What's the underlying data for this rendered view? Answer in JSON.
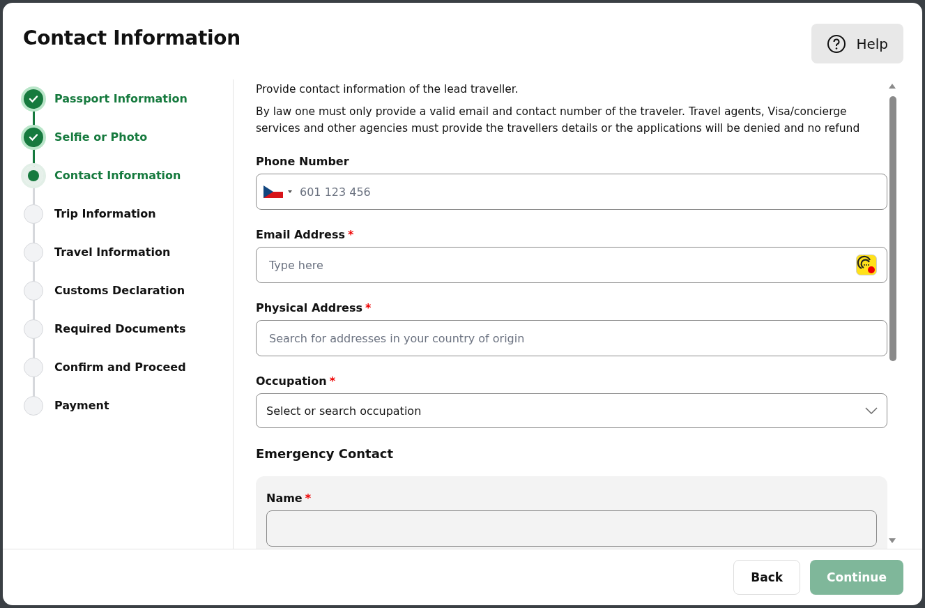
{
  "dialog": {
    "title": "Contact Information",
    "help_button": {
      "label": "Help"
    }
  },
  "steps": [
    {
      "label": "Passport Information",
      "completed": true,
      "selected": false
    },
    {
      "label": "Selfie or Photo",
      "completed": true,
      "selected": false
    },
    {
      "label": "Contact Information",
      "completed": false,
      "selected": true
    },
    {
      "label": "Trip Information",
      "completed": false,
      "selected": false
    },
    {
      "label": "Travel Information",
      "completed": false,
      "selected": false
    },
    {
      "label": "Customs Declaration",
      "completed": false,
      "selected": false
    },
    {
      "label": "Required Documents",
      "completed": false,
      "selected": false
    },
    {
      "label": "Confirm and Proceed",
      "completed": false,
      "selected": false
    },
    {
      "label": "Payment",
      "completed": false,
      "selected": false
    }
  ],
  "intro": [
    "Provide contact information of the lead traveller.",
    "By law one must only provide a valid email and contact number of the traveler. Travel agents, Visa/concierge services and other agencies must provide the travellers details or the applications will be denied and no refund"
  ],
  "fields": [
    {
      "kind": "phone",
      "label": "Phone Number",
      "placeholder": "601 123 456"
    },
    {
      "kind": "text",
      "label": "Email Address",
      "required_mark": "*",
      "placeholder": "Type here",
      "extension_badge": true
    },
    {
      "kind": "text",
      "label": "Physical Address",
      "required_mark": "*",
      "placeholder": "Search for addresses in your country of origin"
    },
    {
      "kind": "select",
      "label": "Occupation",
      "required_mark": "*",
      "value": "Select or search occupation"
    }
  ],
  "emergency_contact": {
    "heading": "Emergency Contact",
    "fields": [
      {
        "kind": "text",
        "label": "Name",
        "required_mark": "*"
      }
    ]
  },
  "footer": {
    "buttons": [
      {
        "label": "Back",
        "kind": "secondary",
        "disabled": false
      },
      {
        "label": "Continue",
        "kind": "primary",
        "disabled": true
      }
    ]
  }
}
